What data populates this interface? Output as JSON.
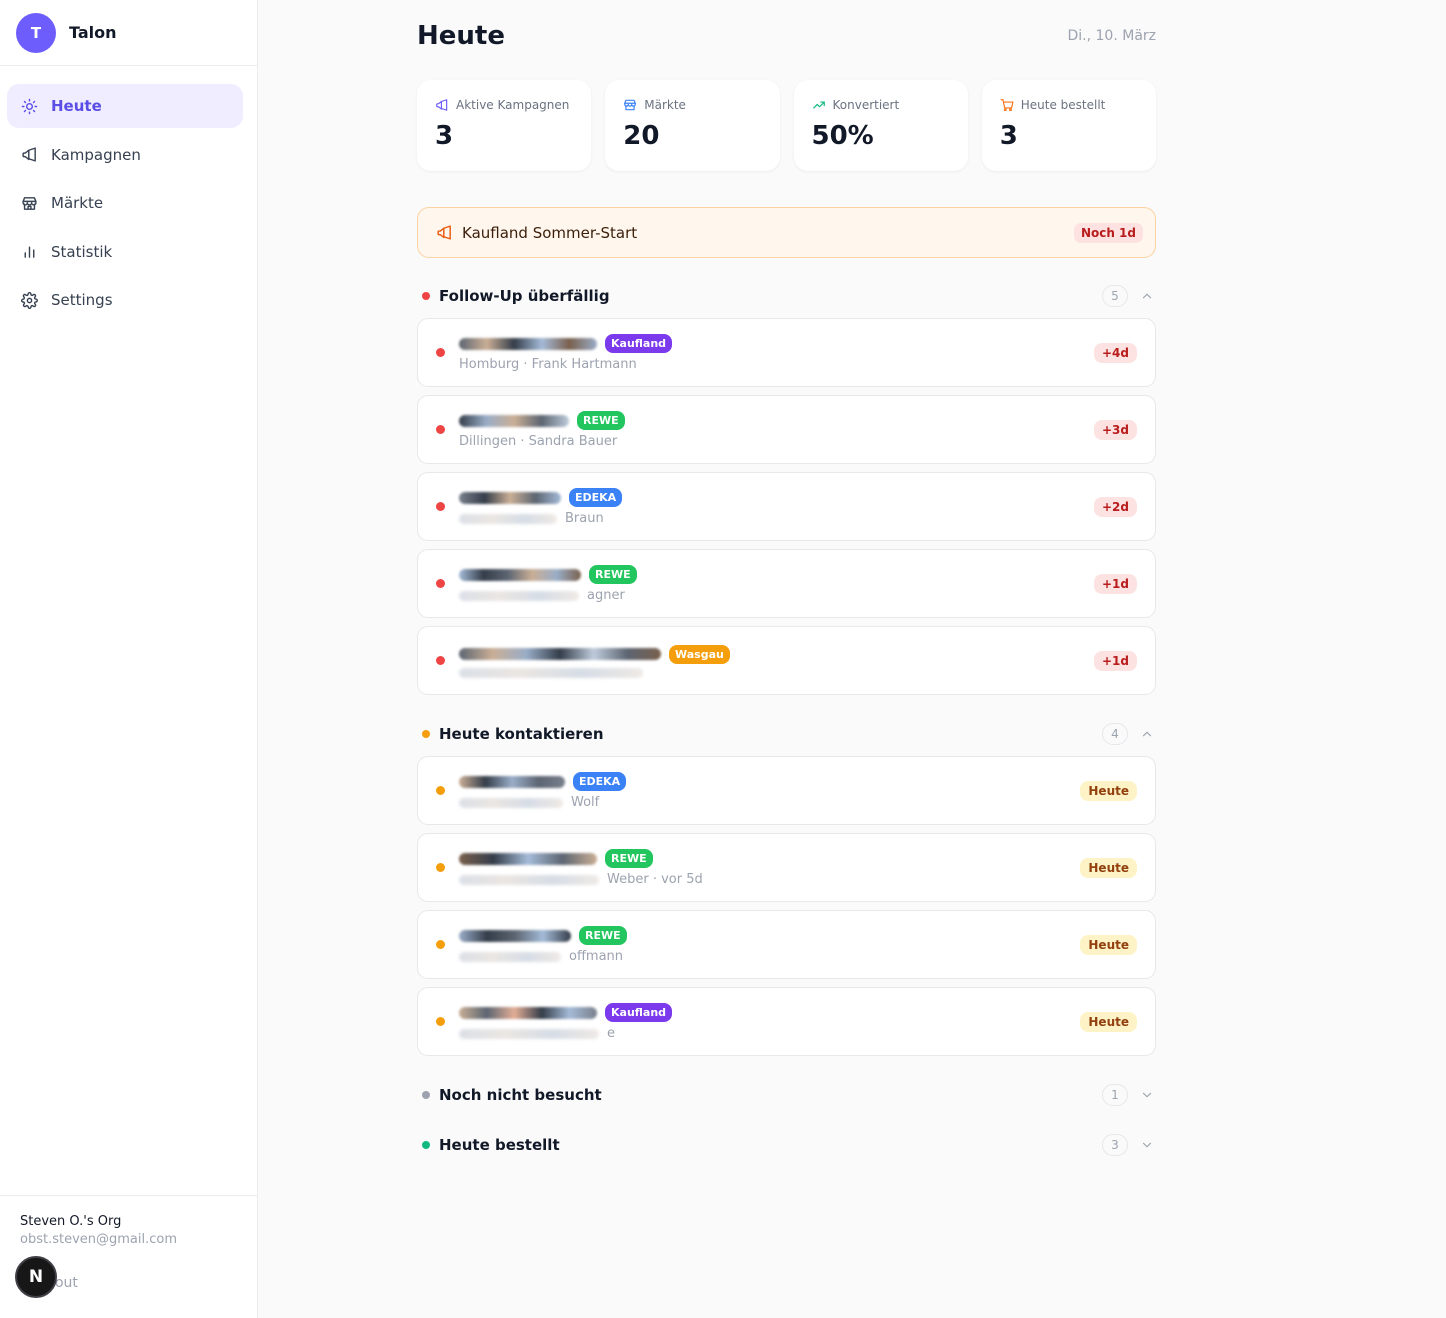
{
  "app": {
    "initial": "T",
    "name": "Talon"
  },
  "nav": [
    {
      "label": "Heute",
      "icon": "sun-icon",
      "active": true
    },
    {
      "label": "Kampagnen",
      "icon": "megaphone-icon",
      "active": false
    },
    {
      "label": "Märkte",
      "icon": "store-icon",
      "active": false
    },
    {
      "label": "Statistik",
      "icon": "bar-chart-icon",
      "active": false
    },
    {
      "label": "Settings",
      "icon": "gear-icon",
      "active": false
    }
  ],
  "account": {
    "org": "Steven O.'s Org",
    "email": "obst.steven@gmail.com",
    "signout": "Sign out",
    "fab_letter": "N"
  },
  "page": {
    "title": "Heute",
    "date": "Di., 10. März"
  },
  "stats": [
    {
      "label": "Aktive Kampagnen",
      "value": "3",
      "icon": "megaphone-icon",
      "color": "#6d5dfc"
    },
    {
      "label": "Märkte",
      "value": "20",
      "icon": "store-icon",
      "color": "#3b82f6"
    },
    {
      "label": "Konvertiert",
      "value": "50%",
      "icon": "trending-up-icon",
      "color": "#10b981"
    },
    {
      "label": "Heute bestellt",
      "value": "3",
      "icon": "cart-icon",
      "color": "#f97316"
    }
  ],
  "campaign": {
    "title": "Kaufland Sommer-Start",
    "badge": "Noch 1d"
  },
  "sections": {
    "followup": {
      "title": "Follow-Up überfällig",
      "count": "5",
      "color": "#ef4444"
    },
    "today": {
      "title": "Heute kontaktieren",
      "count": "4",
      "color": "#f59e0b"
    },
    "notvisited": {
      "title": "Noch nicht besucht",
      "count": "1",
      "color": "#9ca3af"
    },
    "ordered": {
      "title": "Heute bestellt",
      "count": "3",
      "color": "#10b981"
    }
  },
  "chains": {
    "kaufland": {
      "label": "Kaufland",
      "color": "#7c3aed"
    },
    "rewe": {
      "label": "REWE",
      "color": "#22c55e"
    },
    "edeka": {
      "label": "EDEKA",
      "color": "#3b82f6"
    },
    "wasgau": {
      "label": "Wasgau",
      "color": "#f59e0b"
    }
  },
  "followup_items": [
    {
      "chain": "Kaufland",
      "location": "Homburg",
      "contact": "Frank Hartmann",
      "due": "+4d"
    },
    {
      "chain": "REWE",
      "location": "Dillingen",
      "contact": "Sandra Bauer",
      "due": "+3d"
    },
    {
      "chain": "EDEKA",
      "contact_fragment": "Braun",
      "due": "+2d"
    },
    {
      "chain": "REWE",
      "contact_fragment": "agner",
      "due": "+1d"
    },
    {
      "chain": "Wasgau",
      "due": "+1d"
    }
  ],
  "today_items": [
    {
      "chain": "EDEKA",
      "contact_fragment": "Wolf",
      "due": "Heute"
    },
    {
      "chain": "REWE",
      "contact_fragment": "Weber",
      "last_contact": "vor 5d",
      "due": "Heute"
    },
    {
      "chain": "REWE",
      "contact_fragment": "offmann",
      "due": "Heute"
    },
    {
      "chain": "Kaufland",
      "contact_fragment": "e",
      "due": "Heute"
    }
  ]
}
